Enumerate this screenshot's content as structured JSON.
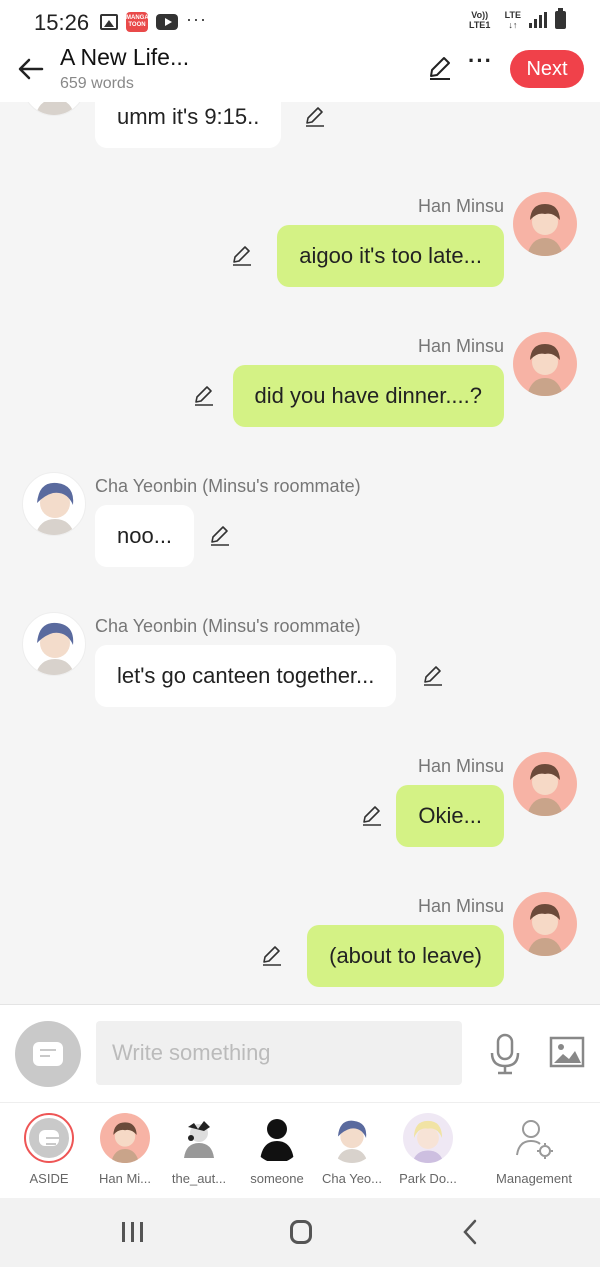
{
  "status_bar": {
    "time": "15:26",
    "network": "LTE",
    "carrier_tag": "Vo)) LTE1",
    "app_badge": "MANGA TOON",
    "overflow": "···"
  },
  "header": {
    "title": "A New Life...",
    "subtitle": "659 words",
    "next_label": "Next",
    "more_label": "···",
    "accent": "#f0414a"
  },
  "messages": [
    {
      "side": "left",
      "speaker": "",
      "text": "umm it's 9:15..",
      "avatar": "cha"
    },
    {
      "side": "right",
      "speaker": "Han Minsu",
      "text": "aigoo it's too late...",
      "avatar": "han"
    },
    {
      "side": "right",
      "speaker": "Han Minsu",
      "text": "did you have dinner....?",
      "avatar": "han"
    },
    {
      "side": "left",
      "speaker": "Cha Yeonbin (Minsu's roommate)",
      "text": "noo...",
      "avatar": "cha"
    },
    {
      "side": "left",
      "speaker": "Cha Yeonbin (Minsu's roommate)",
      "text": "let's go canteen together...",
      "avatar": "cha"
    },
    {
      "side": "right",
      "speaker": "Han Minsu",
      "text": "Okie...",
      "avatar": "han"
    },
    {
      "side": "right",
      "speaker": "Han Minsu",
      "text": "(about to leave)",
      "avatar": "han"
    }
  ],
  "compose": {
    "placeholder": "Write something"
  },
  "characters": [
    {
      "label": "ASIDE"
    },
    {
      "label": "Han Mi..."
    },
    {
      "label": "the_aut..."
    },
    {
      "label": "someone"
    },
    {
      "label": "Cha Yeo..."
    },
    {
      "label": "Park Do..."
    },
    {
      "label": "Management"
    }
  ],
  "colors": {
    "bubble_right": "#d4f285",
    "bubble_left": "#ffffff",
    "background": "#f5f5f5"
  }
}
